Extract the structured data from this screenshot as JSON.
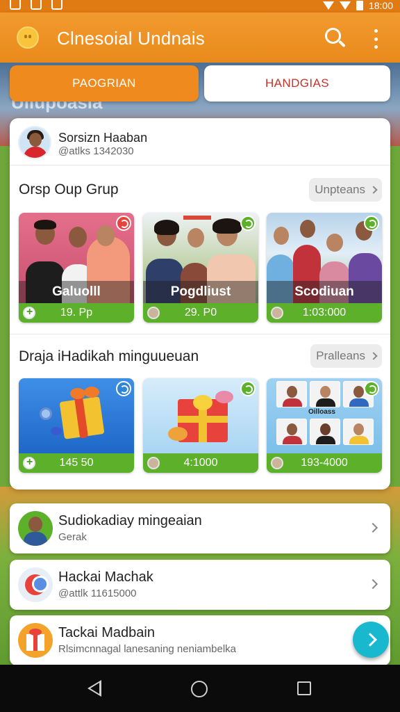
{
  "status_bar": {
    "time": "18:00"
  },
  "app_bar": {
    "title": "Clnesoial Undnais",
    "icons": [
      "app-logo-icon",
      "search-icon",
      "more-vertical-icon"
    ]
  },
  "background": {
    "banner_text": "Ullupoasia"
  },
  "tabs": [
    {
      "label": "PAOGRIAN",
      "active": true
    },
    {
      "label": "HANDGIAS",
      "active": false
    }
  ],
  "profile": {
    "name": "Sorsizn Haaban",
    "handle": "@atlks 1342030"
  },
  "group_section": {
    "title": "Orsp Oup Grup",
    "action_label": "Unpteans",
    "tiles": [
      {
        "label": "Galuolll",
        "footer": "19. Pp",
        "badge": "red"
      },
      {
        "label": "Pogdliust",
        "footer": "29. P0",
        "badge": "green"
      },
      {
        "label": "Scodiuan",
        "footer": "1:03:000",
        "badge": "green"
      }
    ]
  },
  "gift_section": {
    "title": "Draja iHadikah minguueuan",
    "action_label": "Pralleans",
    "tiles": [
      {
        "footer": "145 50",
        "badge": "blue"
      },
      {
        "footer": "4:1000",
        "badge": "green"
      },
      {
        "footer": "193-4000",
        "badge": "green",
        "grid_label": "Oilloass"
      }
    ]
  },
  "list_items": [
    {
      "title": "Sudiokadiay mingeaian",
      "subtitle": "Gerak"
    },
    {
      "title": "Hackai Machak",
      "subtitle": "@attlk 11615000"
    },
    {
      "title": "Tackai Madbain",
      "subtitle": "Rlsimcnnagal lanesaning neniambelka"
    }
  ],
  "colors": {
    "primary": "#ee8a1e",
    "accent_green": "#5cb02a",
    "tab_inactive_text": "#c4322a",
    "fab": "#18b8cf"
  }
}
